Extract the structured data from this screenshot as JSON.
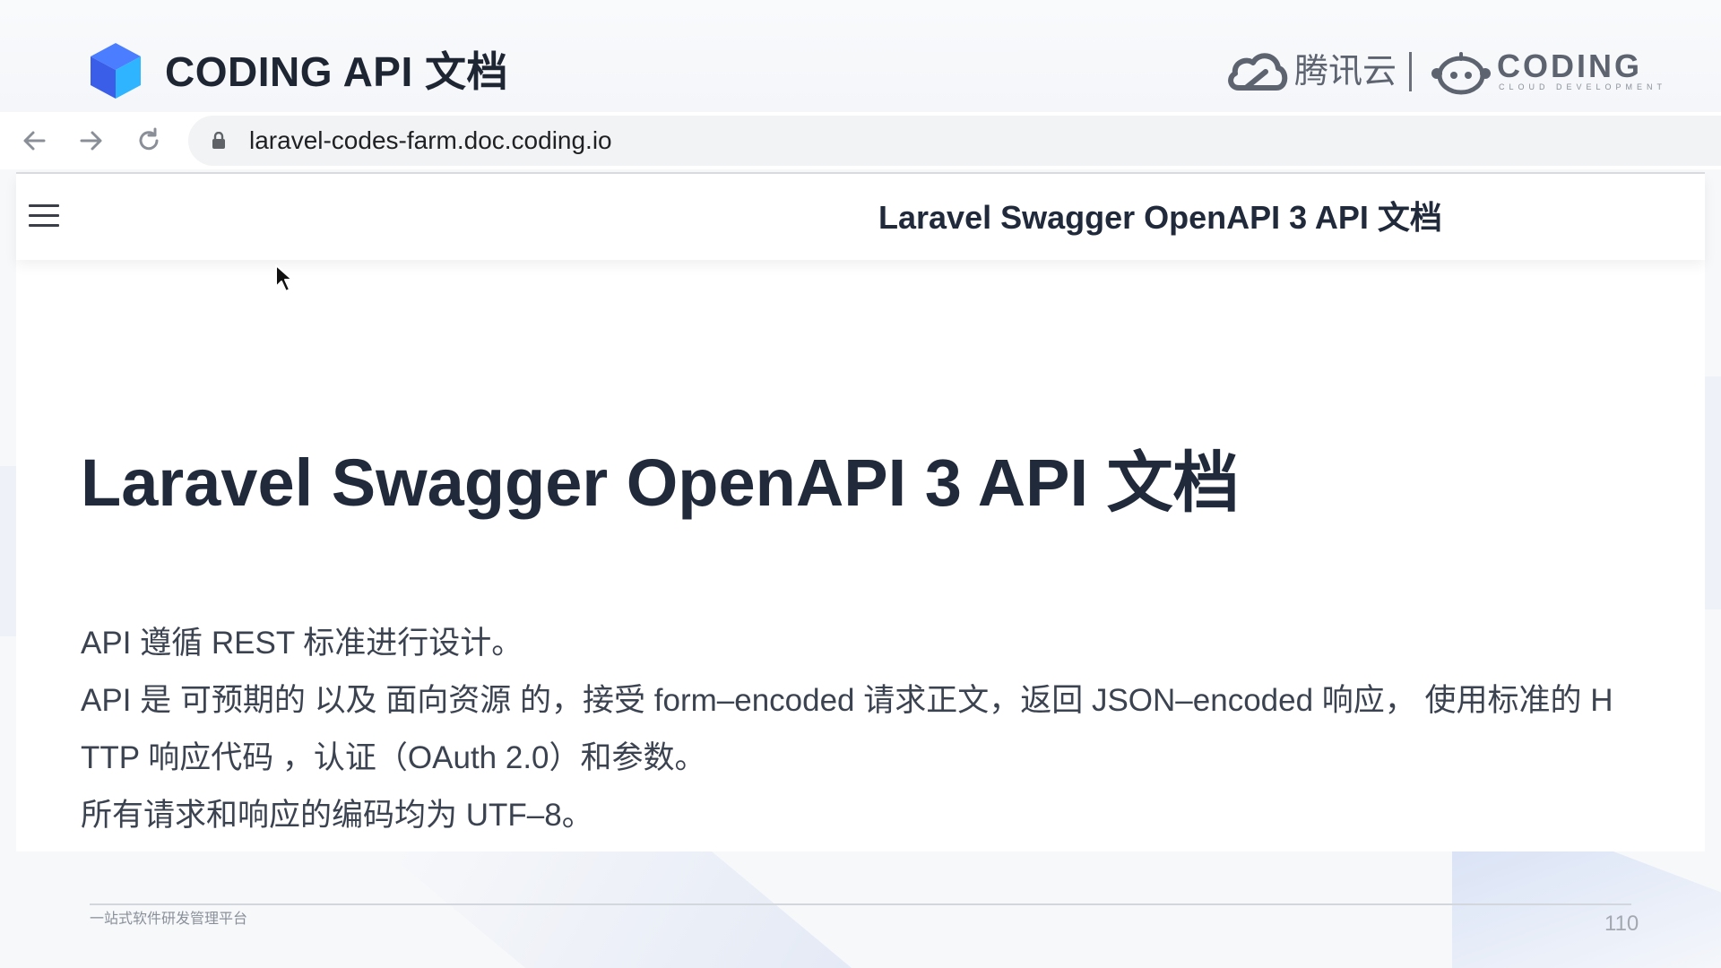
{
  "slide": {
    "title": "CODING API 文档",
    "brand_tencent": "腾讯云",
    "brand_coding": "CODING",
    "brand_coding_sub": "CLOUD DEVELOPMENT",
    "footer_text": "一站式软件研发管理平台",
    "page_number": "110"
  },
  "browser": {
    "url": "laravel-codes-farm.doc.coding.io",
    "icons": [
      "back-arrow-icon",
      "forward-arrow-icon",
      "reload-icon",
      "lock-icon"
    ]
  },
  "page": {
    "header_title": "Laravel Swagger OpenAPI 3 API 文档",
    "h1": "Laravel Swagger OpenAPI 3 API 文档",
    "paragraph_1": "API 遵循 REST 标准进行设计。",
    "paragraph_2_line_1": "API 是 可预期的 以及 面向资源 的，接受 form–encoded 请求正文，返回 JSON–encoded 响应， 使用标准的 H",
    "paragraph_2_line_2": "TTP 响应代码 ，认证（OAuth 2.0）和参数。",
    "paragraph_3": "所有请求和响应的编码均为 UTF–8。"
  },
  "colors": {
    "text_primary": "#212a3a",
    "text_body": "#3c4350",
    "brand_gray": "#5d6470",
    "cube_blue": "#2f6bff"
  }
}
